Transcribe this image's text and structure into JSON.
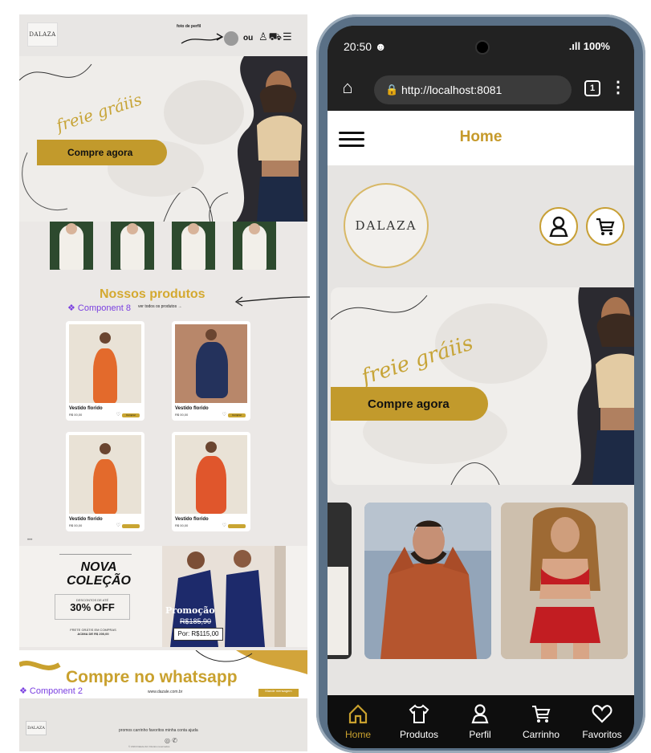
{
  "design": {
    "logo_text": "DALAZA",
    "annotation_foto": "foto de perfil",
    "header_or": "ou",
    "hero": {
      "script_text": "freie gráiis",
      "cta": "Compre agora"
    },
    "products_title": "Nossos produtos",
    "component_label_1": "❖ Component 8",
    "view_all": "ver todos os produtos →",
    "products": [
      {
        "name": "Vestido florido",
        "price": "R$ 00,00",
        "button": "Comprar"
      },
      {
        "name": "Vestido florido",
        "price": "R$ 00,00",
        "button": "Comprar"
      },
      {
        "name": "Vestido florido",
        "price": "R$ 00,00",
        "button": "Comprar"
      },
      {
        "name": "Vestido florido",
        "price": "R$ 00,00",
        "button": "Comprar"
      }
    ],
    "carousel_dots": "•••",
    "collection": {
      "title_line1": "NOVA",
      "title_line2": "COLEÇÃO",
      "discount_small": "DESCONTOS DE ATÉ",
      "discount_big": "30% OFF",
      "shipping_line1": "FRETE GRÁTIS EM COMPRAS",
      "shipping_line2": "ACIMA DE R$ 200,00",
      "promo_title": "Promoção",
      "promo_old_price": "R$185,90",
      "promo_new_price": "Por: R$115,00"
    },
    "whatsapp": {
      "title": "Compre no whatsapp",
      "component_label": "❖ Component 2",
      "url": "www.dazale.com.br",
      "button": "Mande mensagem"
    },
    "footer": {
      "logo_text": "DALAZA",
      "links": "promos  carrinho  favoritos  minha conta  ajuda",
      "social": "◎ ✆",
      "copyright": "© 2024 Dalaza ltd. Direitos reservados"
    }
  },
  "phone": {
    "status_time": "20:50 ☻",
    "status_right": ".ıll 100%",
    "url": "http://localhost:8081",
    "tab_count": "1",
    "app_title": "Home",
    "logo_text": "DALAZA",
    "banner": {
      "script_text": "freie gráiis",
      "cta": "Compre agora"
    },
    "nav": [
      {
        "label": "Home",
        "icon": "home-icon",
        "active": true
      },
      {
        "label": "Produtos",
        "icon": "shirt-icon",
        "active": false
      },
      {
        "label": "Perfil",
        "icon": "user-icon",
        "active": false
      },
      {
        "label": "Carrinho",
        "icon": "cart-icon",
        "active": false
      },
      {
        "label": "Favoritos",
        "icon": "heart-icon",
        "active": false
      }
    ]
  },
  "colors": {
    "gold": "#c9a12e",
    "purple": "#7a3fe0",
    "dark": "#111111"
  }
}
